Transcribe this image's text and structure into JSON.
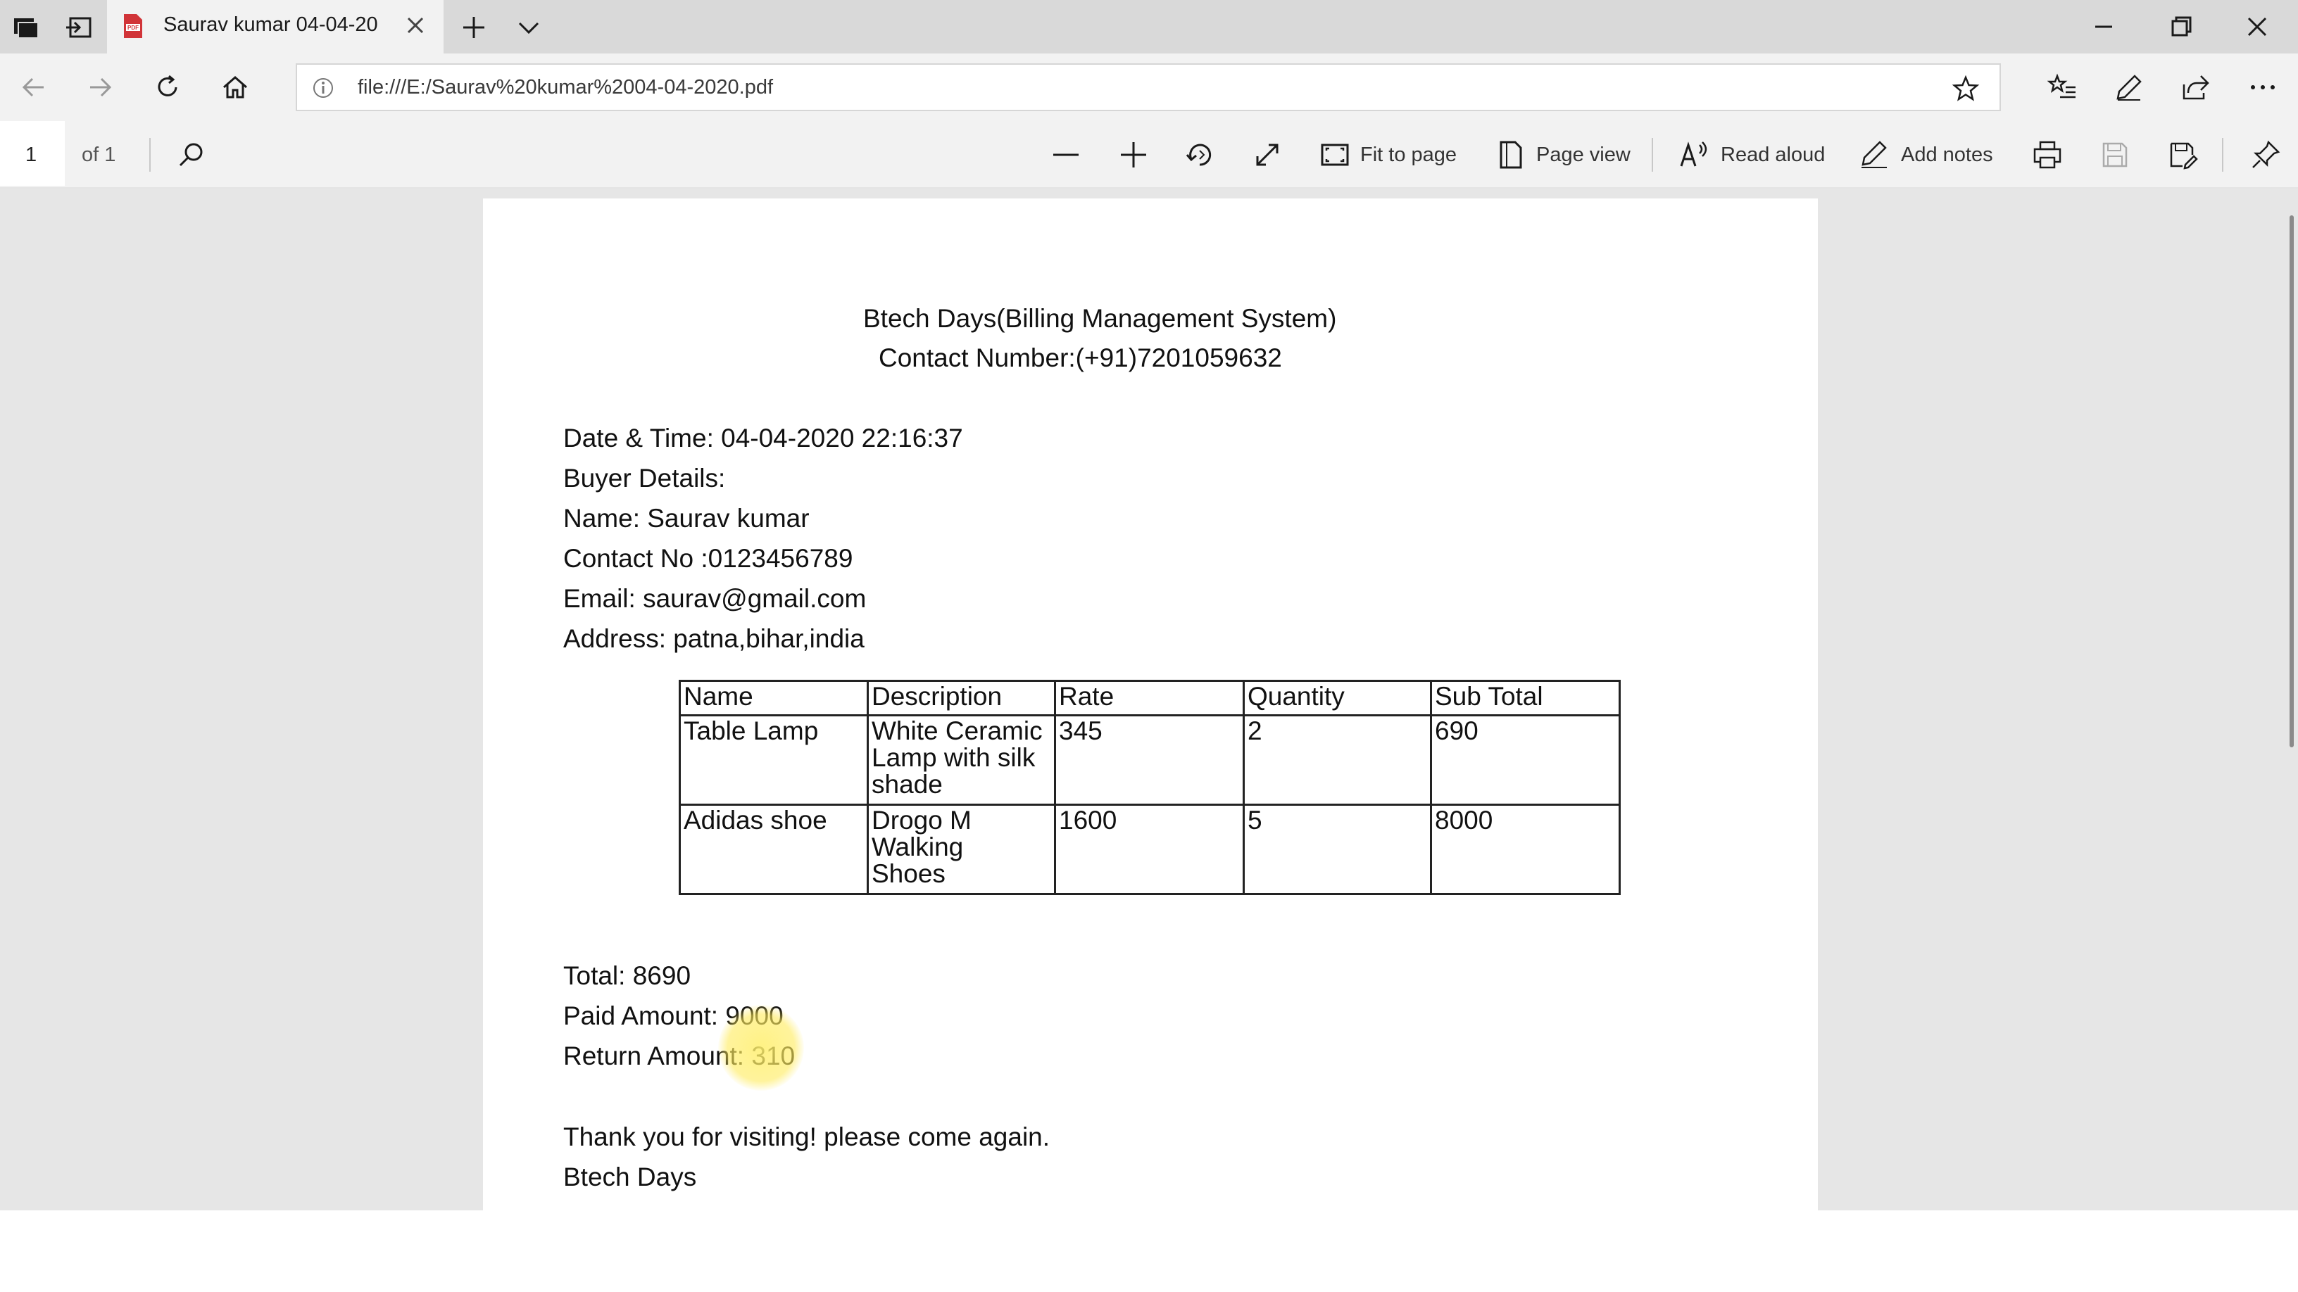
{
  "browser": {
    "tab_title": "Saurav kumar 04-04-20",
    "url": "file:///E:/Saurav%20kumar%2004-04-2020.pdf"
  },
  "pdf_toolbar": {
    "current_page": "1",
    "page_count": "of 1",
    "fit_to_page": "Fit to page",
    "page_view": "Page view",
    "read_aloud": "Read aloud",
    "add_notes": "Add notes"
  },
  "document": {
    "header_title": "Btech Days(Billing Management System)",
    "contact_number": "Contact Number:(+91)7201059632",
    "date_time": "Date & Time: 04-04-2020  22:16:37",
    "buyer_details": "Buyer Details:",
    "name": "Name: Saurav kumar",
    "contact_no": "Contact No :0123456789",
    "email": "Email: saurav@gmail.com",
    "address": "Address: patna,bihar,india",
    "table": {
      "headers": [
        "Name",
        "Description",
        "Rate",
        "Quantity",
        "Sub Total"
      ],
      "rows": [
        {
          "name": "Table Lamp",
          "desc": [
            "White Ceramic",
            "Lamp with silk",
            "shade"
          ],
          "rate": "345",
          "qty": "2",
          "subtotal": "690"
        },
        {
          "name": "Adidas shoe",
          "desc": [
            "Drogo M",
            "Walking",
            "Shoes"
          ],
          "rate": "1600",
          "qty": "5",
          "subtotal": "8000"
        }
      ]
    },
    "total": "Total: 8690",
    "paid_amount": "Paid Amount: 9000",
    "return_amount": "Return Amount: 310",
    "thanks": "Thank you for visiting! please come again.",
    "footer": "Btech Days"
  },
  "icons": {
    "browser": [
      "tab-actions-icon",
      "set-aside-tabs-icon",
      "pdf-file-icon",
      "close-tab-icon",
      "new-tab-icon",
      "tab-list-chevron-icon",
      "minimize-icon",
      "restore-icon",
      "close-window-icon",
      "back-icon",
      "forward-icon",
      "refresh-icon",
      "home-icon",
      "site-info-icon",
      "favorite-star-icon",
      "favorites-list-icon",
      "web-note-icon",
      "share-icon",
      "more-icon"
    ],
    "pdf": [
      "search-icon",
      "zoom-out-icon",
      "zoom-in-icon",
      "rotate-icon",
      "fullscreen-icon",
      "fit-to-page-icon",
      "page-view-icon",
      "read-aloud-icon",
      "add-notes-icon",
      "print-icon",
      "save-icon",
      "save-as-icon",
      "pin-toolbar-icon"
    ]
  },
  "colors": {
    "title_bar": "#d9d9d9",
    "toolbar": "#f2f2f2",
    "viewer_background": "#e6e6e6",
    "page": "#ffffff",
    "cursor_highlight": "#ffeb5a"
  }
}
